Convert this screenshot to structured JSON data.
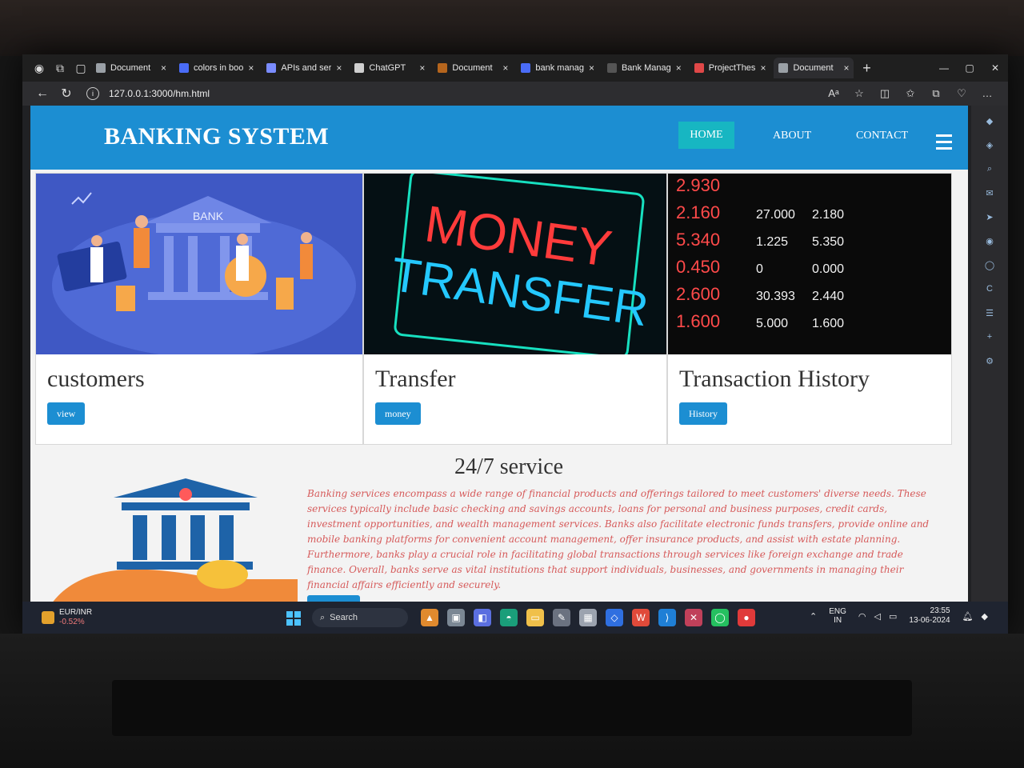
{
  "browser": {
    "tabs": [
      {
        "title": "Document",
        "icon": "page-icon",
        "icon_color": "#9aa0a6"
      },
      {
        "title": "colors in boo",
        "icon": "search-icon",
        "icon_color": "#4a6cf7"
      },
      {
        "title": "APIs and ser",
        "icon": "api-icon",
        "icon_color": "#7a8cff"
      },
      {
        "title": "ChatGPT",
        "icon": "chatgpt-icon",
        "icon_color": "#cfcfcf"
      },
      {
        "title": "Document",
        "icon": "brown-doc-icon",
        "icon_color": "#b5651d"
      },
      {
        "title": "bank manag",
        "icon": "search-icon",
        "icon_color": "#4a6cf7"
      },
      {
        "title": "Bank Manag",
        "icon": "bank-icon",
        "icon_color": "#555"
      },
      {
        "title": "ProjectThes",
        "icon": "project-icon",
        "icon_color": "#e04848"
      },
      {
        "title": "Document",
        "icon": "page-icon",
        "icon_color": "#9aa0a6"
      }
    ],
    "close_glyph": "×",
    "new_tab_glyph": "+",
    "url": "127.0.0.1:3000/hm.html"
  },
  "site": {
    "brand": "BANKING SYSTEM",
    "nav": {
      "home": "HOME",
      "about": "ABOUT",
      "contact": "CONTACT"
    },
    "accent": "#1c8ed2",
    "home_bg": "#17b6c2"
  },
  "cards": [
    {
      "title": "customers",
      "button": "view",
      "image_label": "BANK"
    },
    {
      "title": "Transfer",
      "button": "money",
      "image_line1": "MONEY",
      "image_line2": "TRANSFER"
    },
    {
      "title": "Transaction History",
      "button": "History",
      "ticker": [
        {
          "a": "2.930"
        },
        {
          "a": "2.160",
          "b": "27.000",
          "c": "2.180"
        },
        {
          "a": "5.340",
          "b": "1.225",
          "c": "5.350"
        },
        {
          "a": "0.450",
          "b": "0",
          "c": "0.000"
        },
        {
          "a": "2.600",
          "b": "30.393",
          "c": "2.440"
        },
        {
          "a": "1.600",
          "b": "5.000",
          "c": "1.600"
        }
      ]
    }
  ],
  "service": {
    "title": "24/7 service",
    "text": "Banking services encompass a wide range of financial products and offerings tailored to meet customers' diverse needs. These services typically include basic checking and savings accounts, loans for personal and business purposes, credit cards, investment opportunities, and wealth management services. Banks also facilitate electronic funds transfers, provide online and mobile banking platforms for convenient account management, offer insurance products, and assist with estate planning. Furthermore, banks play a crucial role in facilitating global transactions through services like foreign exchange and trade finance. Overall, banks serve as vital institutions that support individuals, businesses, and governments in managing their financial affairs efficiently and securely."
  },
  "taskbar": {
    "ticker_name": "EUR/INR",
    "ticker_change": "-0.52%",
    "search": "Search",
    "lang1": "ENG",
    "lang2": "IN",
    "time": "23:55",
    "date": "13-06-2024"
  }
}
